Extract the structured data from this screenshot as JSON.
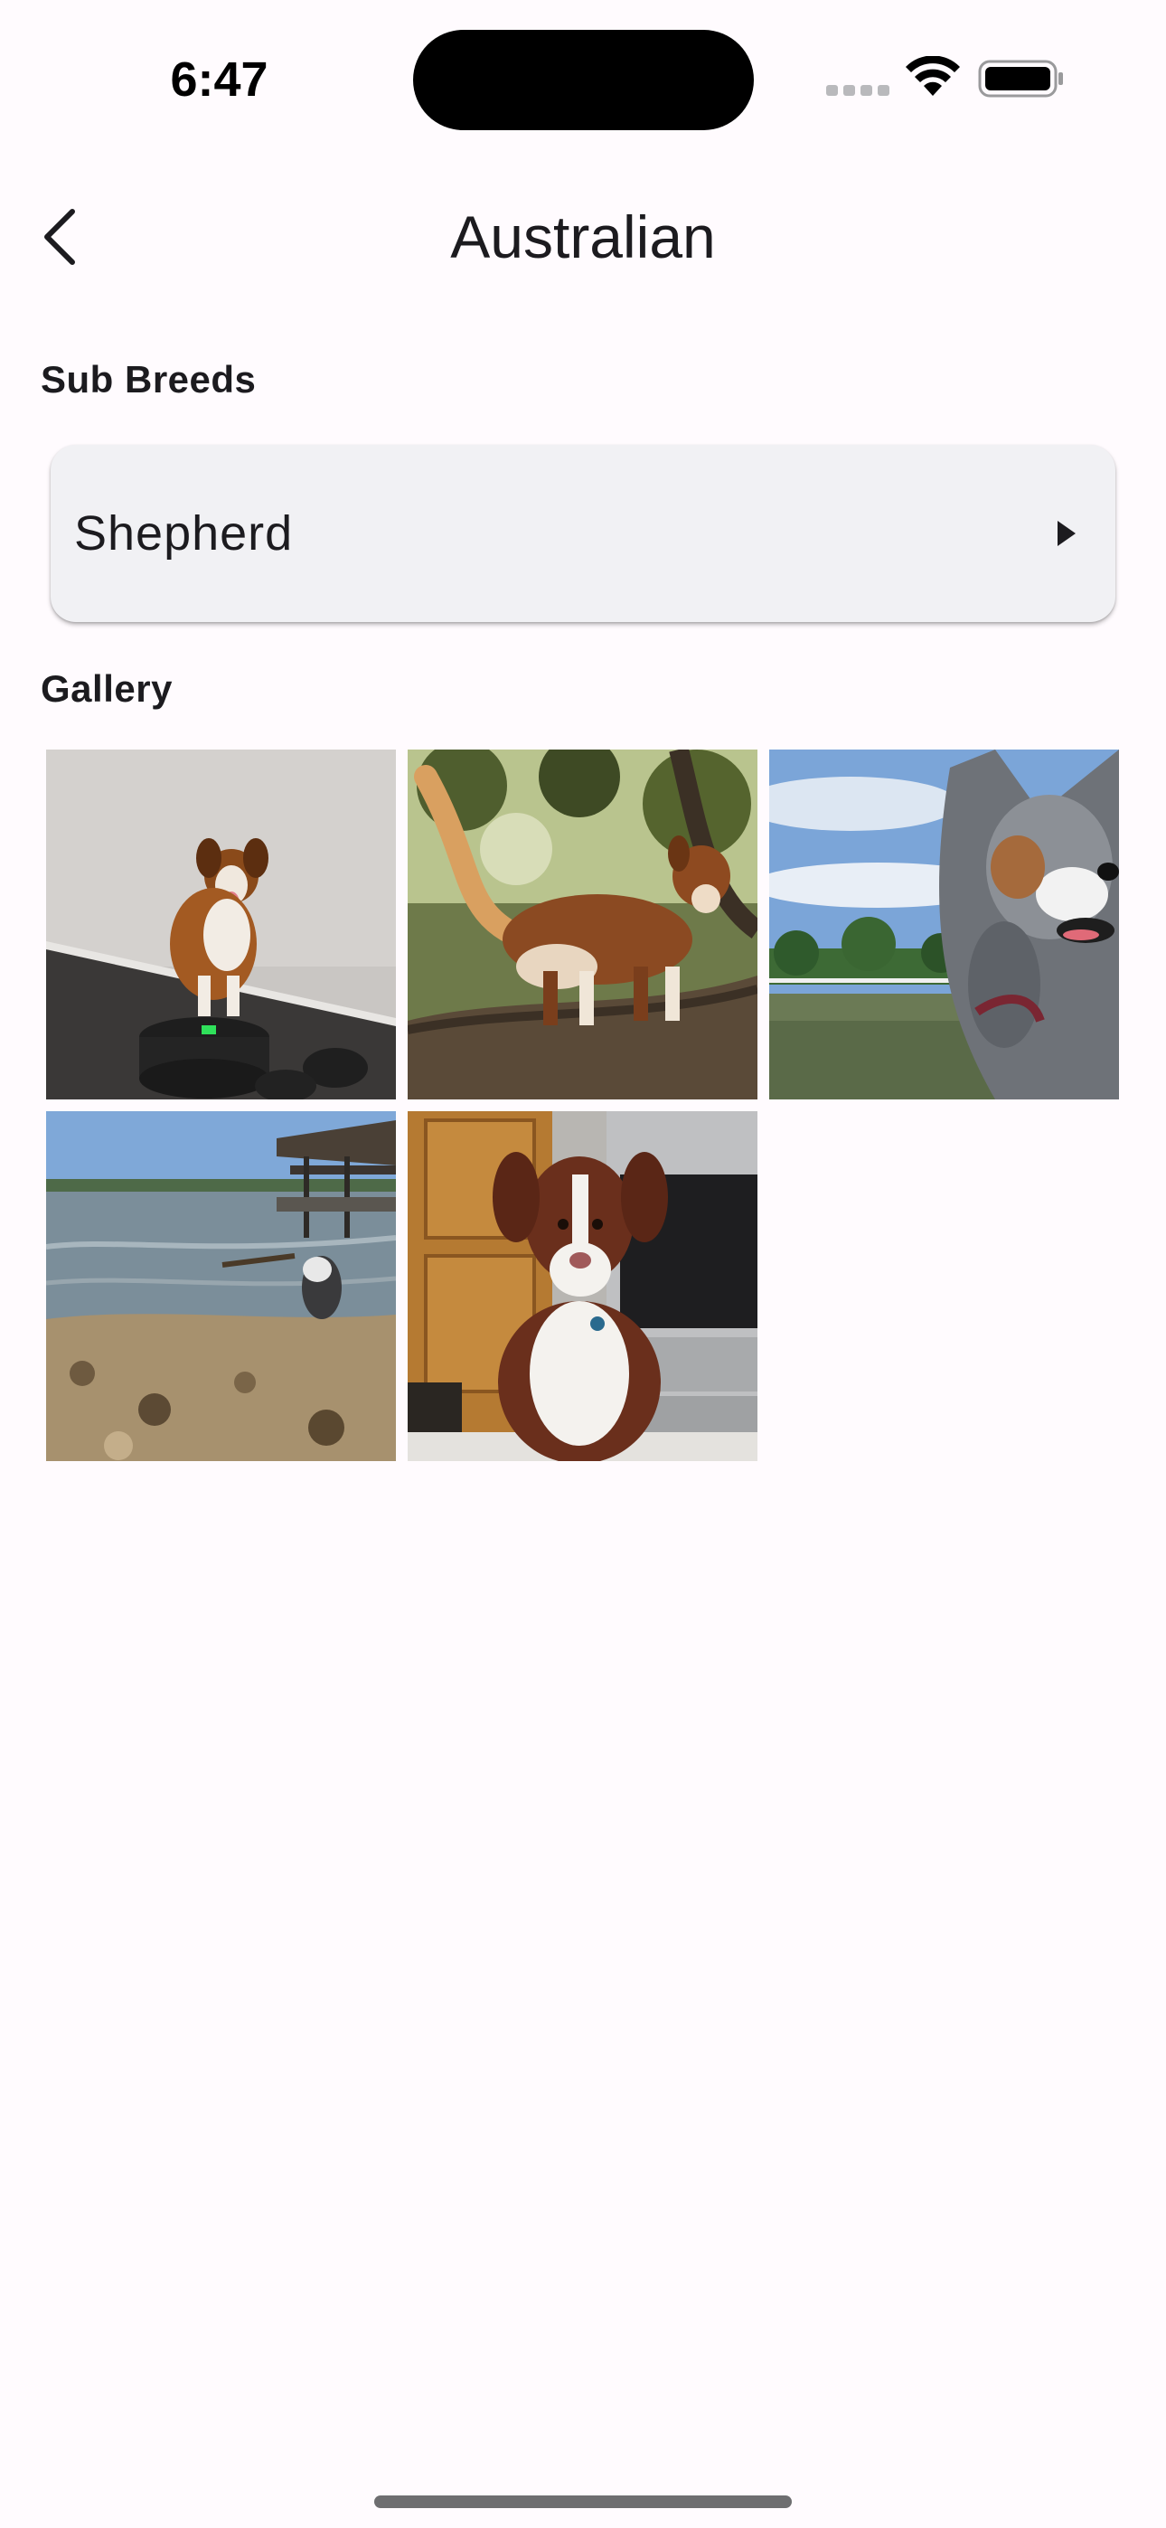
{
  "status_bar": {
    "time": "6:47",
    "signal_icon": "cellular-dots-icon",
    "wifi_icon": "wifi-icon",
    "battery_icon": "battery-icon"
  },
  "app_bar": {
    "back_icon": "chevron-left-icon",
    "title": "Australian"
  },
  "sub_breeds": {
    "heading": "Sub Breeds",
    "items": [
      {
        "label": "Shepherd",
        "trailing_icon": "arrow-right-icon"
      }
    ]
  },
  "gallery": {
    "heading": "Gallery",
    "images": [
      {
        "subject": "dog-on-weight-plates-photo"
      },
      {
        "subject": "dog-on-tree-branch-photo"
      },
      {
        "subject": "merle-dog-by-lake-photo"
      },
      {
        "subject": "dog-in-lake-with-stick-photo"
      },
      {
        "subject": "dog-sitting-in-kitchen-photo"
      }
    ]
  },
  "theme": {
    "background": "#FFFBFE",
    "card": "#F1F1F4",
    "text": "#1C1B1F"
  }
}
